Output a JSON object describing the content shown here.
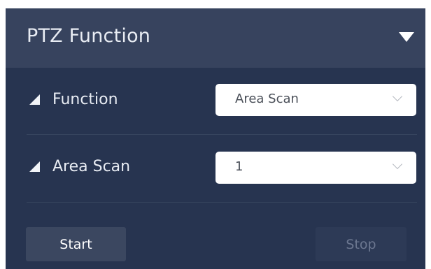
{
  "panel": {
    "title": "PTZ Function",
    "icons": {
      "collapse": "caret-down-icon",
      "row_marker": "triangle-icon",
      "select": "chevron-down-icon"
    }
  },
  "rows": [
    {
      "label": "Function",
      "value": "Area Scan"
    },
    {
      "label": "Area Scan",
      "value": "1"
    }
  ],
  "buttons": {
    "start": "Start",
    "stop": "Stop"
  },
  "colors": {
    "panel_bg": "#273450",
    "header_bg": "#37435e",
    "start_bg": "#3b4760",
    "stop_bg": "#2d3a56",
    "stop_text": "#6c7790"
  }
}
